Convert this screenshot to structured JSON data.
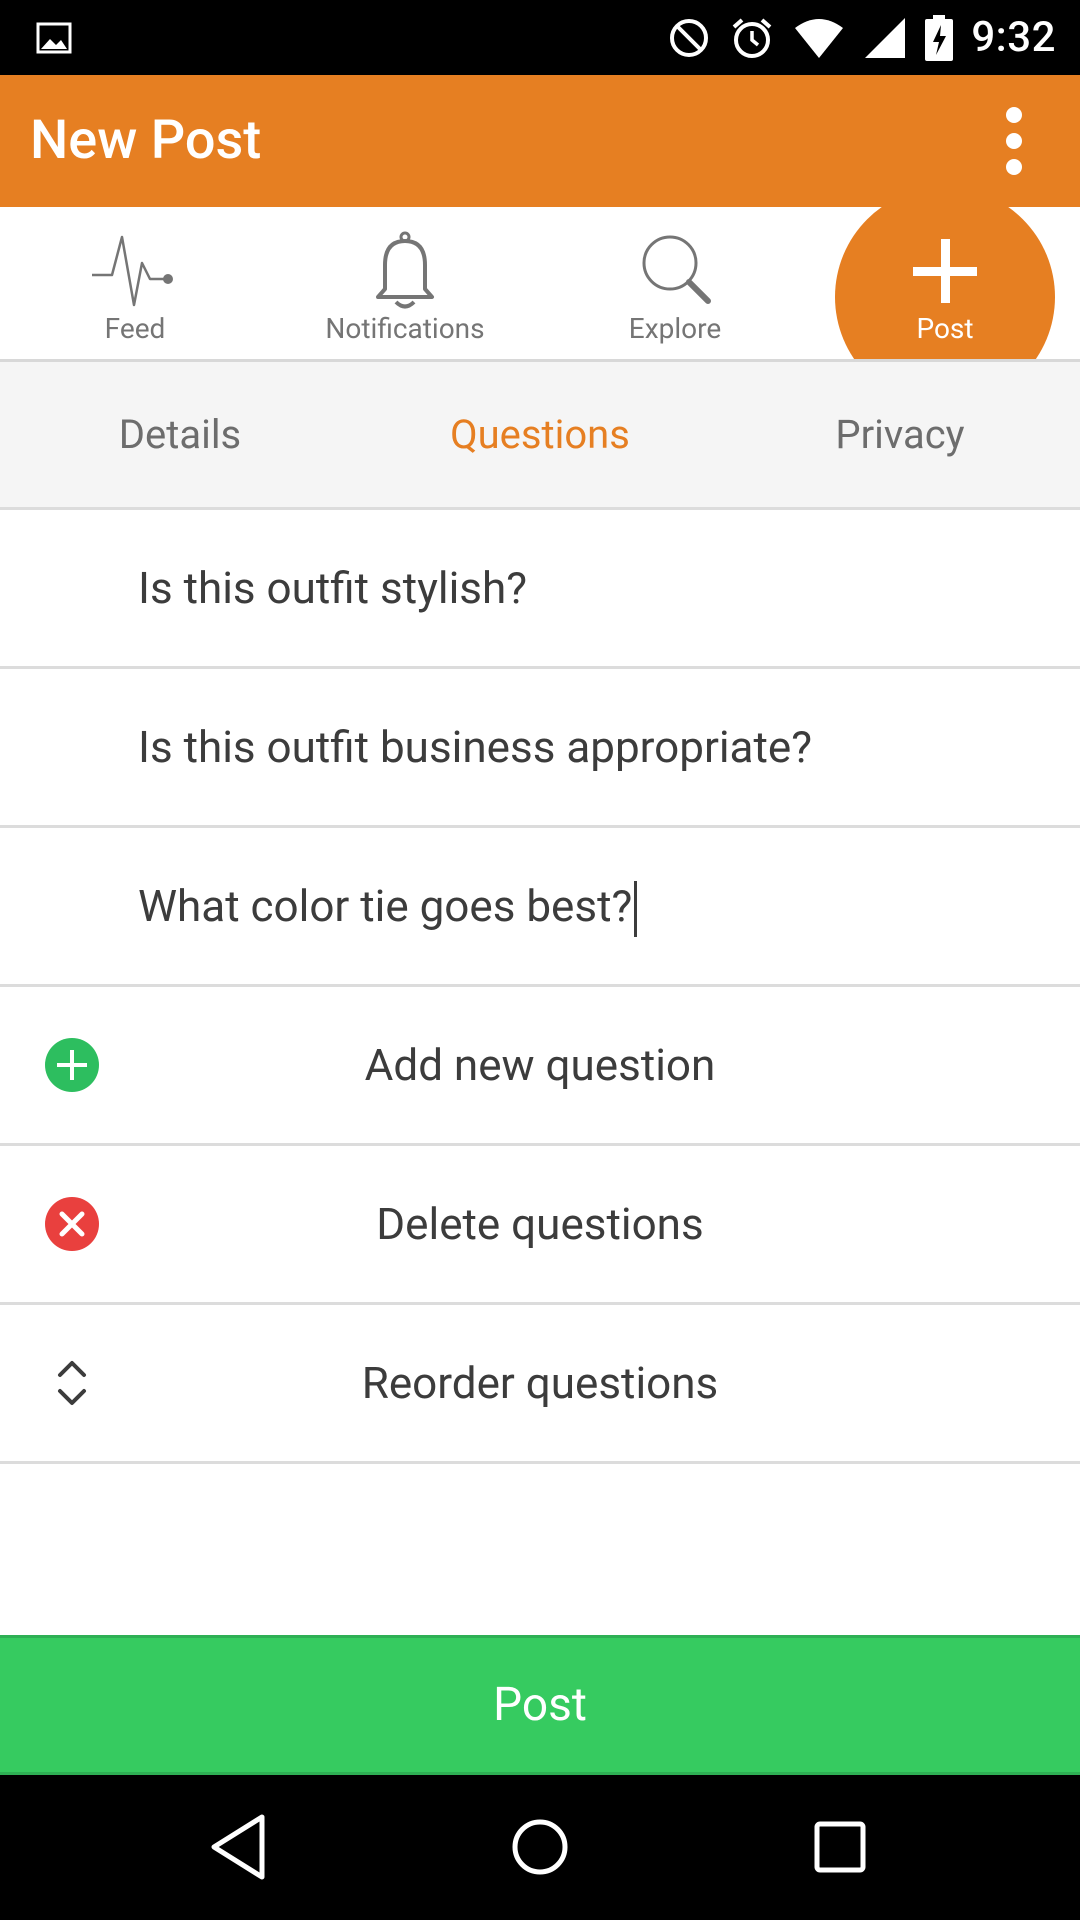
{
  "status_bar": {
    "time": "9:32",
    "icons": [
      "image-icon",
      "do-not-disturb-icon",
      "alarm-icon",
      "wifi-icon",
      "signal-icon",
      "battery-charging-icon"
    ]
  },
  "app_bar": {
    "title": "New Post",
    "menu_icon": "more-vert-icon"
  },
  "nav": {
    "items": [
      {
        "label": "Feed",
        "icon": "activity-icon"
      },
      {
        "label": "Notifications",
        "icon": "bell-icon"
      },
      {
        "label": "Explore",
        "icon": "search-icon"
      },
      {
        "label": "Post",
        "icon": "plus-icon"
      }
    ]
  },
  "tabs": {
    "items": [
      {
        "label": "Details"
      },
      {
        "label": "Questions"
      },
      {
        "label": "Privacy"
      }
    ],
    "active": "Questions"
  },
  "questions": [
    {
      "text": "Is this outfit stylish?"
    },
    {
      "text": "Is this outfit business appropriate?"
    },
    {
      "text": "What color tie goes best?"
    }
  ],
  "actions": {
    "add": {
      "label": "Add new question",
      "icon": "add-circle-icon"
    },
    "delete": {
      "label": "Delete questions",
      "icon": "cancel-circle-icon"
    },
    "reorder": {
      "label": "Reorder questions",
      "icon": "unfold-icon"
    }
  },
  "post_button": {
    "label": "Post"
  },
  "colors": {
    "accent": "#E67F22",
    "post_green": "#36CB60",
    "add_green": "#2DBE5F",
    "delete_red": "#E9403E"
  }
}
